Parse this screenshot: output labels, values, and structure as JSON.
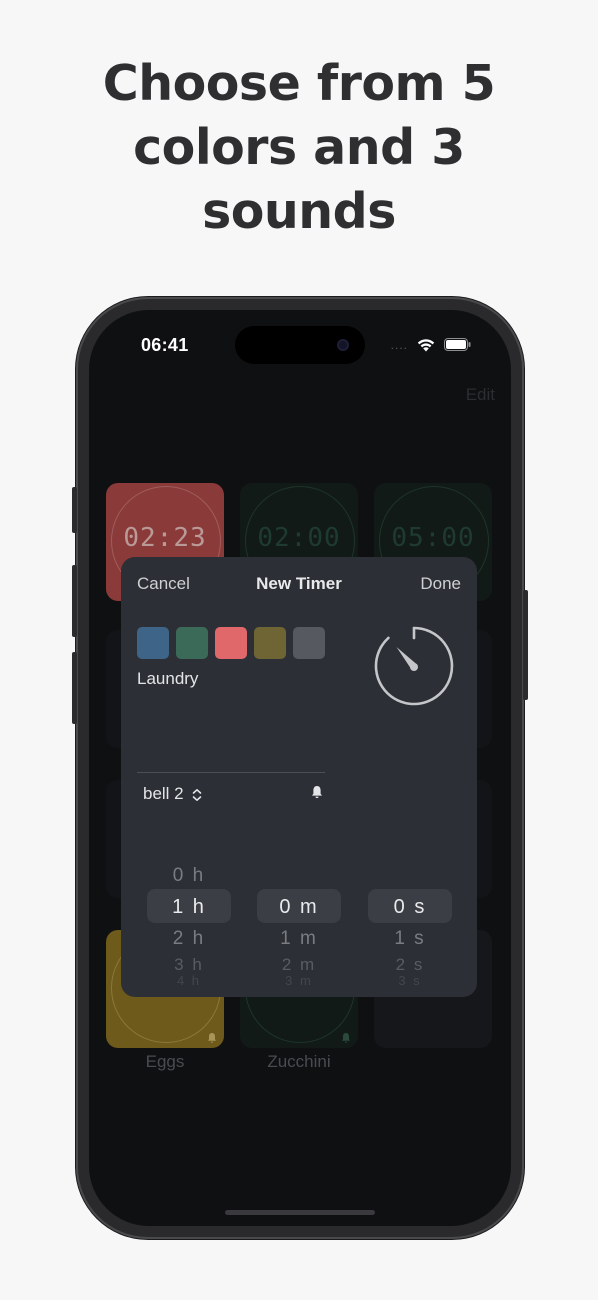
{
  "headline": {
    "line1": "Choose from 5",
    "line2": "colors and 3",
    "line3": "sounds"
  },
  "status_bar": {
    "time": "06:41",
    "signal": "....",
    "wifi_icon": "wifi-icon",
    "battery_icon": "battery-icon"
  },
  "toolbar": {
    "edit_label": "Edit"
  },
  "timers": [
    {
      "time": "02:23",
      "color": "#8a3a39",
      "text_color": "#b99a97"
    },
    {
      "time": "02:00",
      "color": "#121a17",
      "text_color": "#1f3b31"
    },
    {
      "time": "05:00",
      "color": "#121a17",
      "text_color": "#1f3b31"
    },
    {
      "label": "Eggs",
      "color": "#6e5a1a"
    },
    {
      "label": "Zucchini",
      "color": "#121a17"
    },
    {
      "label": "",
      "color": "#16171a"
    }
  ],
  "modal": {
    "cancel_label": "Cancel",
    "title": "New Timer",
    "done_label": "Done",
    "colors": [
      "#3e6487",
      "#3c6a58",
      "#e0686a",
      "#6e6434",
      "#56595f"
    ],
    "name": "Laundry",
    "sound": "bell 2",
    "hours": {
      "above": "0 h",
      "selected": "1 h",
      "below": "2 h",
      "below2": "3 h",
      "below3": "4 h"
    },
    "minutes": {
      "above": "",
      "selected": "0 m",
      "below": "1 m",
      "below2": "2 m",
      "below3": "3 m"
    },
    "seconds": {
      "above": "",
      "selected": "0 s",
      "below": "1 s",
      "below2": "2 s",
      "below3": "3 s"
    }
  }
}
